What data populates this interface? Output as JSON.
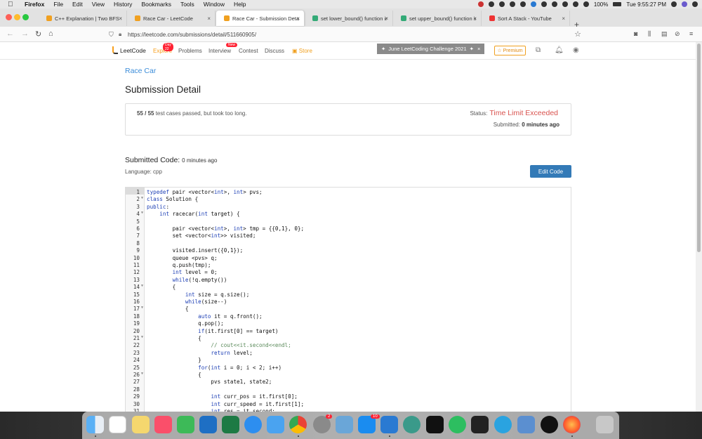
{
  "menubar": {
    "app": "Firefox",
    "items": [
      "File",
      "Edit",
      "View",
      "History",
      "Bookmarks",
      "Tools",
      "Window",
      "Help"
    ],
    "battery": "100%",
    "clock": "Tue 9:55:27 PM"
  },
  "tabs": [
    {
      "title": "C++ Explanation | Two BFS Solu",
      "color": "#f0a020"
    },
    {
      "title": "Race Car - LeetCode",
      "color": "#f0a020"
    },
    {
      "title": "Race Car - Submission Detail - L",
      "color": "#f0a020",
      "active": true
    },
    {
      "title": "set lower_bound() function in C",
      "color": "#3a7"
    },
    {
      "title": "set upper_bound() function in C",
      "color": "#3a7"
    },
    {
      "title": "Sort A Stack - YouTube",
      "color": "#e33"
    }
  ],
  "url": "https://leetcode.com/submissions/detail/511660905/",
  "lc_nav": {
    "logo": "LeetCode",
    "explore": "Explore",
    "explore_badge": "Day 22",
    "problems": "Problems",
    "interview": "Interview",
    "interview_badge": "New",
    "contest": "Contest",
    "discuss": "Discuss",
    "store": "Store",
    "banner": "June LeetCoding Challenge 2021",
    "premium": "Premium"
  },
  "problem_title": "Race Car",
  "heading": "Submission Detail",
  "result": {
    "passed": "55 / 55",
    "passed_text": "test cases passed, but took too long.",
    "status_label": "Status:",
    "status_value": "Time Limit Exceeded",
    "submitted_label": "Submitted:",
    "submitted_value": "0 minutes ago"
  },
  "submitted_code": {
    "label": "Submitted Code:",
    "time": "0 minutes ago",
    "language": "Language: cpp",
    "edit_button": "Edit Code"
  },
  "code_lines": [
    "typedef pair <vector<int>, int> pvs;",
    "class Solution {",
    "public:",
    "    int racecar(int target) {",
    "",
    "        pair <vector<int>, int> tmp = {{0,1}, 0};",
    "        set <vector<int>> visited;",
    "",
    "        visited.insert({0,1});",
    "        queue <pvs> q;",
    "        q.push(tmp);",
    "        int level = 0;",
    "        while(!q.empty())",
    "        {",
    "            int size = q.size();",
    "            while(size--)",
    "            {",
    "                auto it = q.front();",
    "                q.pop();",
    "                if(it.first[0] == target)",
    "                {",
    "                    // cout<<it.second<<endl;",
    "                    return level;",
    "                }",
    "                for(int i = 0; i < 2; i++)",
    "                {",
    "                    pvs state1, state2;",
    "",
    "                    int curr_pos = it.first[0];",
    "                    int curr_speed = it.first[1];",
    "                    int res = it.second;"
  ],
  "fold_lines": [
    2,
    4,
    14,
    17,
    21,
    26
  ],
  "dock_badges": {
    "system_prefs": "2",
    "app_store": "10"
  }
}
